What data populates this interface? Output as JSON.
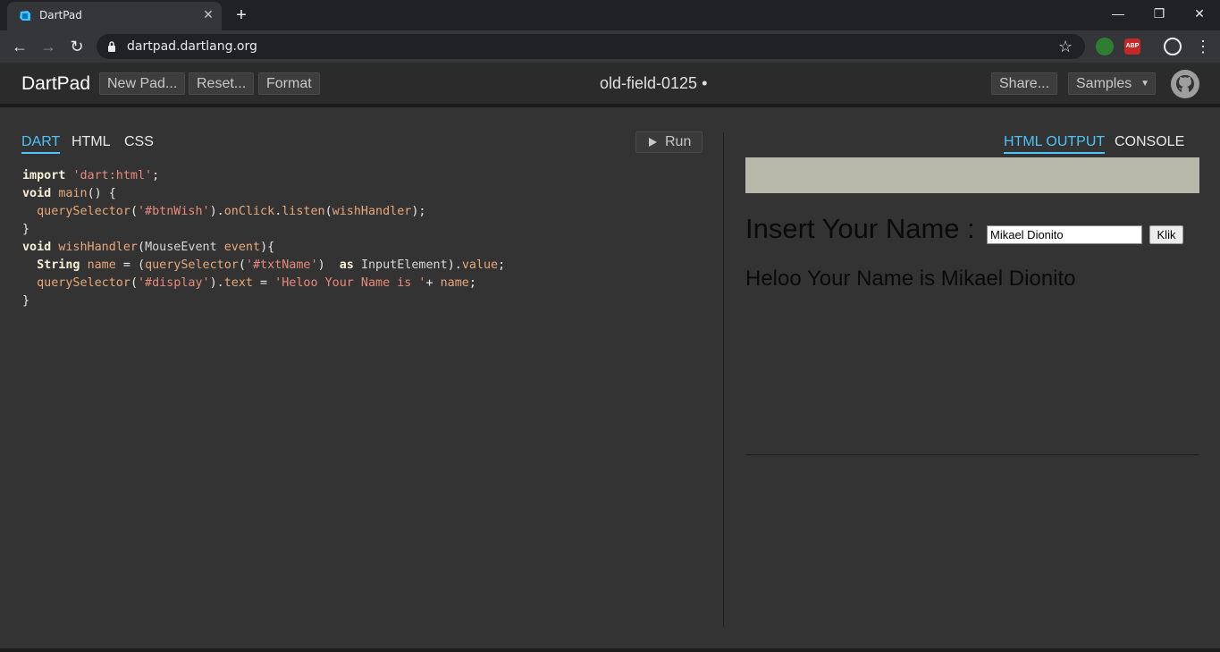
{
  "browser": {
    "tab_title": "DartPad",
    "tab_favicon": "dart-logo-icon",
    "url_host": "dartpad.dartlang.org",
    "window_controls": [
      "minimize-icon",
      "restore-icon",
      "close-icon"
    ]
  },
  "dartpad": {
    "logo": "DartPad",
    "buttons": {
      "new_pad": "New Pad...",
      "reset": "Reset...",
      "format": "Format",
      "share": "Share...",
      "samples": "Samples"
    },
    "pad_name": "old-field-0125 •"
  },
  "editor": {
    "tabs": [
      {
        "label": "DART",
        "active": true
      },
      {
        "label": "HTML",
        "active": false
      },
      {
        "label": "CSS",
        "active": false
      }
    ],
    "run_label": "Run",
    "code_lines": [
      "import 'dart:html';",
      "void main() {",
      "  querySelector('#btnWish').onClick.listen(wishHandler);",
      "}",
      "void wishHandler(MouseEvent event){",
      "  String name = (querySelector('#txtName')  as InputElement).value;",
      "  querySelector('#display').text = 'Heloo Your Name is '+ name;",
      "}"
    ]
  },
  "output": {
    "tabs": [
      {
        "label": "HTML OUTPUT",
        "active": true
      },
      {
        "label": "CONSOLE",
        "active": false
      }
    ],
    "heading": "Insert Your Name :",
    "input_value": "Mikael Dionito",
    "button_label": "Klik",
    "display_text": "Heloo Your Name is Mikael Dionito"
  },
  "colors": {
    "accent": "#4fc3f7",
    "banner": "#b8b9ab"
  }
}
